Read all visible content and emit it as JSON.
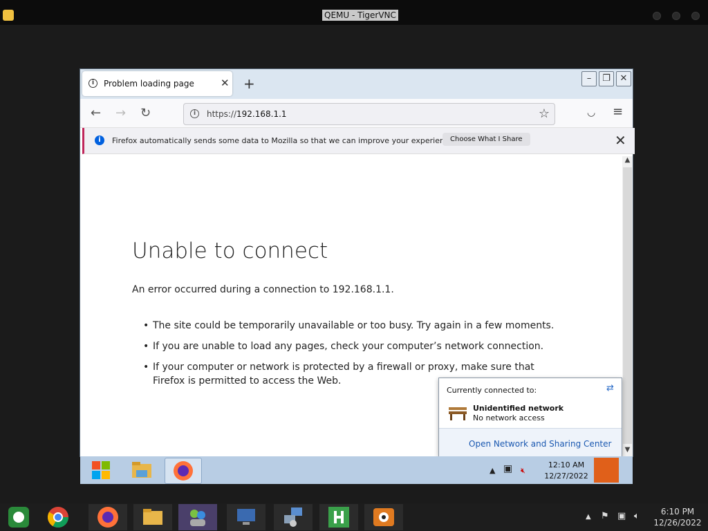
{
  "vnc": {
    "title": "QEMU - TigerVNC"
  },
  "browser": {
    "tab_title": "Problem loading page",
    "new_tab": "+",
    "url_scheme": "https://",
    "url_host": "192.168.1.1",
    "notification": {
      "message": "Firefox automatically sends some data to Mozilla so that we can improve your experience.",
      "button": "Choose What I Share"
    },
    "page": {
      "heading": "Unable to connect",
      "description": "An error occurred during a connection to 192.168.1.1.",
      "bullets": [
        "The site could be temporarily unavailable or too busy. Try again in a few moments.",
        "If you are unable to load any pages, check your computer’s network connection.",
        "If your computer or network is protected by a firewall or proxy, make sure that Firefox is permitted to access the Web."
      ]
    }
  },
  "network_popup": {
    "header": "Currently connected to:",
    "network_name": "Unidentified network",
    "network_status": "No network access",
    "link": "Open Network and Sharing Center"
  },
  "vm_taskbar": {
    "time": "12:10 AM",
    "date": "12/27/2022"
  },
  "host_taskbar": {
    "time": "6:10 PM",
    "date": "12/26/2022"
  },
  "icons": [
    "windows-start-icon",
    "file-explorer-icon",
    "firefox-icon",
    "chrome-icon",
    "network-bench-icon",
    "volume-muted-icon",
    "network-tray-icon",
    "flag-icon"
  ],
  "colors": {
    "accent_blue": "#0060df",
    "link_blue": "#1a58b0",
    "notification_stripe": "#c0265b",
    "vm_taskbar": "#b8cde4"
  }
}
